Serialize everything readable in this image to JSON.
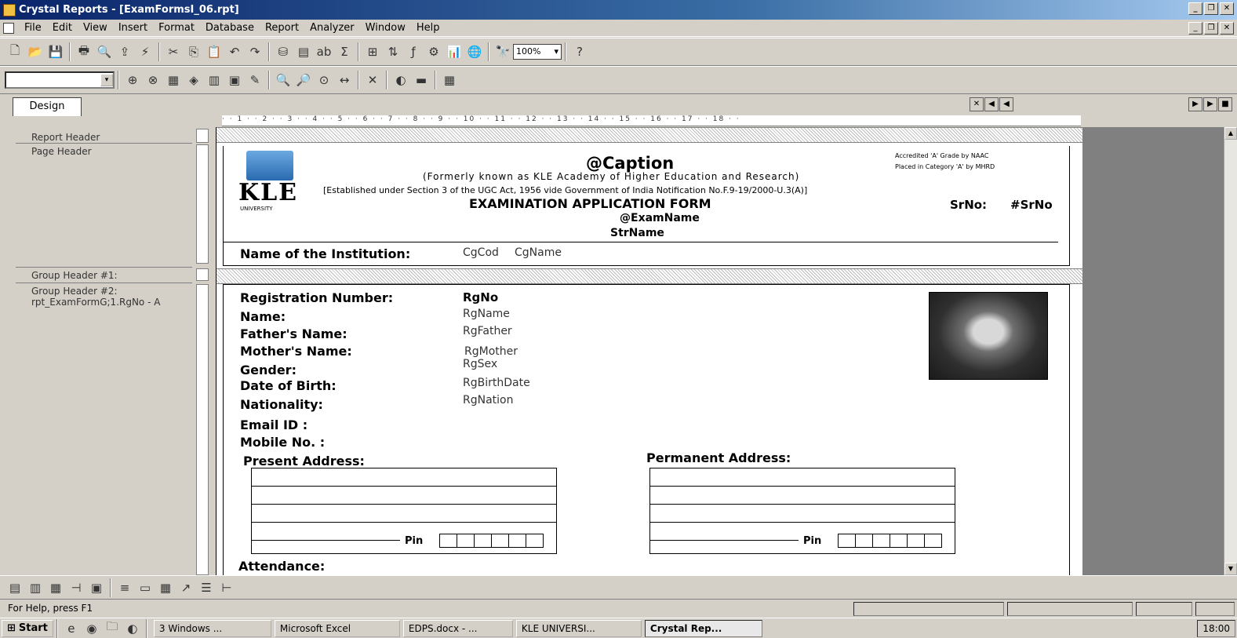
{
  "window": {
    "title": "Crystal Reports - [ExamFormsI_06.rpt]"
  },
  "menu": [
    "File",
    "Edit",
    "View",
    "Insert",
    "Format",
    "Database",
    "Report",
    "Analyzer",
    "Window",
    "Help"
  ],
  "toolbar": {
    "zoom": "100%"
  },
  "tabs": {
    "design": "Design"
  },
  "sections": {
    "report_header": "Report Header",
    "page_header": "Page Header",
    "group_header_1": "Group Header #1:",
    "group_header_2_line1": "Group Header #2:",
    "group_header_2_line2": "rpt_ExamFormG;1.RgNo - A"
  },
  "ruler": "· · 1 · · 2 · · 3 · · 4 · · 5 · · 6 · · 7 · · 8 · · 9 · · 10 · · 11 · · 12 · · 13 · · 14 · · 15 · · 16 · · 17 · · 18 · ·",
  "report": {
    "caption": "@Caption",
    "formerly": "(Formerly known as KLE Academy of Higher Education and Research)",
    "established": "[Established under Section 3 of the UGC Act, 1956 vide Government of India Notification No.F.9-19/2000-U.3(A)]",
    "accredited": "Accredited 'A' Grade by NAAC",
    "placed": "Placed in Category 'A' by MHRD",
    "form_title": "EXAMINATION APPLICATION FORM",
    "exam_name": "@ExamName",
    "str_name": "StrName",
    "srno_label": "SrNo:",
    "srno_field": "#SrNo",
    "institution_label": "Name of the Institution:",
    "cg_code": "CgCod",
    "cg_name": "CgName",
    "logo_text": "KLE",
    "logo_sub": "UNIVERSITY",
    "labels": {
      "reg": "Registration Number:",
      "name": "Name:",
      "father": "Father's Name:",
      "mother": "Mother's Name:",
      "gender": "Gender:",
      "dob": "Date of Birth:",
      "nationality": "Nationality:",
      "email": "Email ID :",
      "mobile": "Mobile No. :",
      "present": "Present Address:",
      "permanent": "Permanent Address:",
      "pin": "Pin",
      "attendance": "Attendance:"
    },
    "fields": {
      "reg": "RgNo",
      "name": "RgName",
      "father": "RgFather",
      "mother": "RgMother",
      "sex": "RgSex",
      "dob": "RgBirthDate",
      "nation": "RgNation"
    }
  },
  "status": {
    "help": "For Help, press F1"
  },
  "taskbar": {
    "start": "Start",
    "tasks": [
      "3 Windows ...",
      "Microsoft Excel",
      "EDPS.docx - ...",
      "KLE UNIVERSI...",
      "Crystal Rep..."
    ],
    "time": "18:00"
  }
}
